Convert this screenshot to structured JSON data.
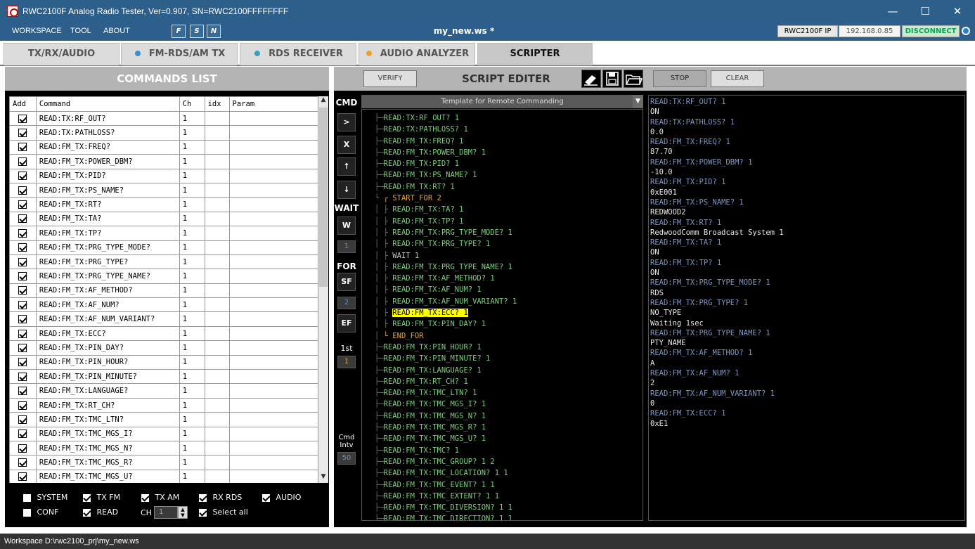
{
  "window": {
    "title": "RWC2100F Analog Radio Tester, Ver=0.907, SN=RWC2100FFFFFFFF",
    "min": "—",
    "max": "☐",
    "close": "✕"
  },
  "menubar": {
    "items": [
      "WORKSPACE",
      "TOOL",
      "ABOUT"
    ],
    "boxes": [
      "F",
      "S",
      "N"
    ],
    "workspace_name": "my_new.ws *",
    "ip_label": "RWC2100F IP",
    "ip_value": "192.168.0.85",
    "disconnect": "DISCONNECT"
  },
  "tabs": [
    {
      "label": "TX/RX/AUDIO",
      "dot": ""
    },
    {
      "label": "FM-RDS/AM TX",
      "dot": "#3a8fd0"
    },
    {
      "label": "RDS RECEIVER",
      "dot": "#3a9fc0"
    },
    {
      "label": "AUDIO ANALYZER",
      "dot": "#f0a030"
    },
    {
      "label": "SCRIPTER",
      "dot": ""
    }
  ],
  "commands_list": {
    "title": "COMMANDS LIST",
    "headers": [
      "Add",
      "Command",
      "Ch",
      "idx",
      "Param"
    ],
    "rows": [
      {
        "cmd": "READ:TX:RF_OUT?",
        "ch": "1"
      },
      {
        "cmd": "READ:TX:PATHLOSS?",
        "ch": "1"
      },
      {
        "cmd": "READ:FM_TX:FREQ?",
        "ch": "1"
      },
      {
        "cmd": "READ:FM_TX:POWER_DBM?",
        "ch": "1"
      },
      {
        "cmd": "READ:FM_TX:PID?",
        "ch": "1"
      },
      {
        "cmd": "READ:FM_TX:PS_NAME?",
        "ch": "1"
      },
      {
        "cmd": "READ:FM_TX:RT?",
        "ch": "1"
      },
      {
        "cmd": "READ:FM_TX:TA?",
        "ch": "1"
      },
      {
        "cmd": "READ:FM_TX:TP?",
        "ch": "1"
      },
      {
        "cmd": "READ:FM_TX:PRG_TYPE_MODE?",
        "ch": "1"
      },
      {
        "cmd": "READ:FM_TX:PRG_TYPE?",
        "ch": "1"
      },
      {
        "cmd": "READ:FM_TX:PRG_TYPE_NAME?",
        "ch": "1"
      },
      {
        "cmd": "READ:FM_TX:AF_METHOD?",
        "ch": "1"
      },
      {
        "cmd": "READ:FM_TX:AF_NUM?",
        "ch": "1"
      },
      {
        "cmd": "READ:FM_TX:AF_NUM_VARIANT?",
        "ch": "1"
      },
      {
        "cmd": "READ:FM_TX:ECC?",
        "ch": "1"
      },
      {
        "cmd": "READ:FM_TX:PIN_DAY?",
        "ch": "1"
      },
      {
        "cmd": "READ:FM_TX:PIN_HOUR?",
        "ch": "1"
      },
      {
        "cmd": "READ:FM_TX:PIN_MINUTE?",
        "ch": "1"
      },
      {
        "cmd": "READ:FM_TX:LANGUAGE?",
        "ch": "1"
      },
      {
        "cmd": "READ:FM_TX:RT_CH?",
        "ch": "1"
      },
      {
        "cmd": "READ:FM_TX:TMC_LTN?",
        "ch": "1"
      },
      {
        "cmd": "READ:FM_TX:TMC_MGS_I?",
        "ch": "1"
      },
      {
        "cmd": "READ:FM_TX:TMC_MGS_N?",
        "ch": "1"
      },
      {
        "cmd": "READ:FM_TX:TMC_MGS_R?",
        "ch": "1"
      },
      {
        "cmd": "READ:FM_TX:TMC_MGS_U?",
        "ch": "1"
      }
    ],
    "filters_row1": [
      "SYSTEM",
      "TX FM",
      "TX AM",
      "RX RDS",
      "AUDIO"
    ],
    "filters_row2_conf": "CONF",
    "filters_row2_read": "READ",
    "ch_label": "CH",
    "ch_value": "1",
    "select_all": "Select all"
  },
  "script_editor": {
    "verify": "VERIFY",
    "title": "SCRIPT EDITER",
    "stop": "STOP",
    "clear": "CLEAR",
    "template": "Template for Remote Commanding",
    "cmd_label": "CMD",
    "cmd_buttons": [
      ">",
      "X",
      "↑",
      "↓"
    ],
    "wait_label": "WAIT",
    "wait_btn": "W",
    "wait_value": "1",
    "for_label": "FOR",
    "sf_btn": "SF",
    "for_value": "2",
    "ef_btn": "EF",
    "first_label": "1st",
    "first_value": "1",
    "intv_label": "Cmd Intv",
    "intv_value": "50",
    "lines": [
      {
        "t": "READ:TX:RF_OUT? 1",
        "k": "c",
        "i": 0
      },
      {
        "t": "READ:TX:PATHLOSS? 1",
        "k": "c",
        "i": 0
      },
      {
        "t": "READ:FM_TX:FREQ? 1",
        "k": "c",
        "i": 0
      },
      {
        "t": "READ:FM_TX:POWER_DBM? 1",
        "k": "c",
        "i": 0
      },
      {
        "t": "READ:FM_TX:PID? 1",
        "k": "c",
        "i": 0
      },
      {
        "t": "READ:FM_TX:PS_NAME? 1",
        "k": "c",
        "i": 0
      },
      {
        "t": "READ:FM_TX:RT? 1",
        "k": "c",
        "i": 0
      },
      {
        "t": "START_FOR 2",
        "k": "s",
        "i": 0
      },
      {
        "t": "READ:FM_TX:TA? 1",
        "k": "c",
        "i": 1
      },
      {
        "t": "READ:FM_TX:TP? 1",
        "k": "c",
        "i": 1
      },
      {
        "t": "READ:FM_TX:PRG_TYPE_MODE? 1",
        "k": "c",
        "i": 1
      },
      {
        "t": "READ:FM_TX:PRG_TYPE? 1",
        "k": "c",
        "i": 1
      },
      {
        "t": "WAIT 1",
        "k": "w",
        "i": 1
      },
      {
        "t": "READ:FM_TX:PRG_TYPE_NAME? 1",
        "k": "c",
        "i": 1
      },
      {
        "t": "READ:FM_TX:AF_METHOD? 1",
        "k": "c",
        "i": 1
      },
      {
        "t": "READ:FM_TX:AF_NUM? 1",
        "k": "c",
        "i": 1
      },
      {
        "t": "READ:FM_TX:AF_NUM_VARIANT? 1",
        "k": "c",
        "i": 1
      },
      {
        "t": "READ:FM_TX:ECC? 1",
        "k": "h",
        "i": 1
      },
      {
        "t": "READ:FM_TX:PIN_DAY? 1",
        "k": "c",
        "i": 1
      },
      {
        "t": "END_FOR",
        "k": "e",
        "i": 0
      },
      {
        "t": "READ:FM_TX:PIN_HOUR? 1",
        "k": "c",
        "i": 0
      },
      {
        "t": "READ:FM_TX:PIN_MINUTE? 1",
        "k": "c",
        "i": 0
      },
      {
        "t": "READ:FM_TX:LANGUAGE? 1",
        "k": "c",
        "i": 0
      },
      {
        "t": "READ:FM_TX:RT_CH? 1",
        "k": "c",
        "i": 0
      },
      {
        "t": "READ:FM_TX:TMC_LTN? 1",
        "k": "c",
        "i": 0
      },
      {
        "t": "READ:FM_TX:TMC_MGS_I? 1",
        "k": "c",
        "i": 0
      },
      {
        "t": "READ:FM_TX:TMC_MGS_N? 1",
        "k": "c",
        "i": 0
      },
      {
        "t": "READ:FM_TX:TMC_MGS_R? 1",
        "k": "c",
        "i": 0
      },
      {
        "t": "READ:FM_TX:TMC_MGS_U? 1",
        "k": "c",
        "i": 0
      },
      {
        "t": "READ:FM_TX:TMC? 1",
        "k": "c",
        "i": 0
      },
      {
        "t": "READ:FM_TX:TMC_GROUP? 1 2",
        "k": "c",
        "i": 0
      },
      {
        "t": "READ:FM_TX:TMC_LOCATION? 1 1",
        "k": "c",
        "i": 0
      },
      {
        "t": "READ:FM_TX:TMC_EVENT? 1 1",
        "k": "c",
        "i": 0
      },
      {
        "t": "READ:FM_TX:TMC_EXTENT? 1 1",
        "k": "c",
        "i": 0
      },
      {
        "t": "READ:FM_TX:TMC_DIVERSION? 1 1",
        "k": "c",
        "i": 0
      },
      {
        "t": "READ:FM_TX:TMC_DIRECTION? 1 1",
        "k": "c",
        "i": 0
      }
    ],
    "output": [
      {
        "t": "READ:TX:RF_OUT? 1",
        "k": "cmd"
      },
      {
        "t": "ON",
        "k": "res"
      },
      {
        "t": "READ:TX:PATHLOSS? 1",
        "k": "cmd"
      },
      {
        "t": "0.0",
        "k": "res"
      },
      {
        "t": "READ:FM_TX:FREQ? 1",
        "k": "cmd"
      },
      {
        "t": "87.70",
        "k": "res"
      },
      {
        "t": "READ:FM_TX:POWER_DBM? 1",
        "k": "cmd"
      },
      {
        "t": "-10.0",
        "k": "res"
      },
      {
        "t": "READ:FM_TX:PID? 1",
        "k": "cmd"
      },
      {
        "t": "0xE001",
        "k": "res"
      },
      {
        "t": "READ:FM_TX:PS_NAME? 1",
        "k": "cmd"
      },
      {
        "t": "REDWOOD2",
        "k": "res"
      },
      {
        "t": "READ:FM_TX:RT? 1",
        "k": "cmd"
      },
      {
        "t": "RedwoodComm Broadcast System 1",
        "k": "res"
      },
      {
        "t": "READ:FM_TX:TA? 1",
        "k": "cmd"
      },
      {
        "t": "ON",
        "k": "res"
      },
      {
        "t": "READ:FM_TX:TP? 1",
        "k": "cmd"
      },
      {
        "t": "ON",
        "k": "res"
      },
      {
        "t": "READ:FM_TX:PRG_TYPE_MODE? 1",
        "k": "cmd"
      },
      {
        "t": "RDS",
        "k": "res"
      },
      {
        "t": "READ:FM_TX:PRG_TYPE? 1",
        "k": "cmd"
      },
      {
        "t": "NO_TYPE",
        "k": "res"
      },
      {
        "t": "Waiting 1sec",
        "k": "res"
      },
      {
        "t": "READ:FM_TX:PRG_TYPE_NAME? 1",
        "k": "cmd"
      },
      {
        "t": "PTY_NAME",
        "k": "res"
      },
      {
        "t": "READ:FM_TX:AF_METHOD? 1",
        "k": "cmd"
      },
      {
        "t": "A",
        "k": "res"
      },
      {
        "t": "READ:FM_TX:AF_NUM? 1",
        "k": "cmd"
      },
      {
        "t": "2",
        "k": "res"
      },
      {
        "t": "READ:FM_TX:AF_NUM_VARIANT? 1",
        "k": "cmd"
      },
      {
        "t": "0",
        "k": "res"
      },
      {
        "t": "READ:FM_TX:ECC? 1",
        "k": "cmd"
      },
      {
        "t": "0xE1",
        "k": "res"
      }
    ]
  },
  "statusbar": {
    "text": "Workspace  D:\\rwc2100_prj\\my_new.ws"
  },
  "colors": {
    "titlebar": "#2d5f8b",
    "highlight": "#ffff00",
    "script_green": "#7fd07f",
    "script_orange": "#f0a030",
    "output_blue": "#7f97bf"
  }
}
